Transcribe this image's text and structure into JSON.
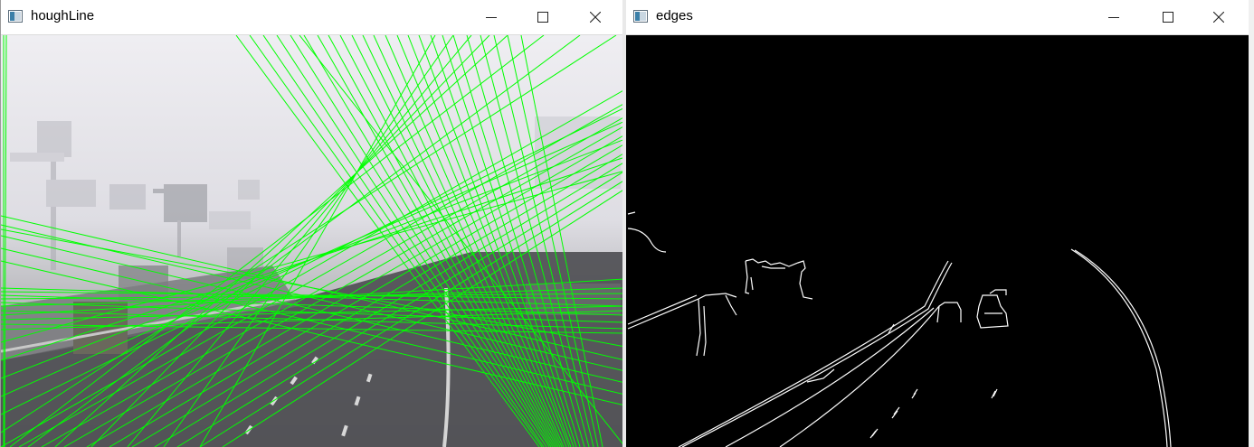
{
  "windows": {
    "left": {
      "title": "houghLine",
      "icon": "image-window-icon"
    },
    "right": {
      "title": "edges",
      "icon": "image-window-icon"
    }
  },
  "controls": [
    "minimize-icon",
    "maximize-icon",
    "close-icon"
  ],
  "colors": {
    "hough_line": "#00ff00",
    "edge_line": "#ffffff",
    "edges_bg": "#000000",
    "fog_sky": "#e6e5ea",
    "road": "#4a4b4f"
  }
}
